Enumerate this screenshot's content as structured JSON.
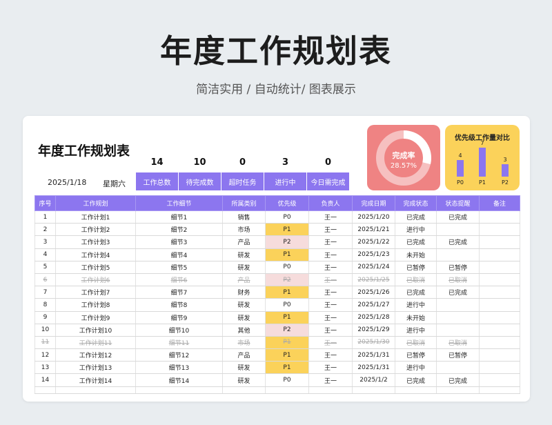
{
  "hero": {
    "title": "年度工作规划表",
    "subtitle": "简洁实用 / 自动统计/ 图表展示"
  },
  "card": {
    "title": "年度工作规划表",
    "date": "2025/1/18",
    "weekday": "星期六"
  },
  "stats": [
    {
      "value": "14",
      "label": "工作总数"
    },
    {
      "value": "10",
      "label": "待完成数"
    },
    {
      "value": "0",
      "label": "超时任务"
    },
    {
      "value": "3",
      "label": "进行中"
    },
    {
      "value": "0",
      "label": "今日需完成"
    }
  ],
  "completion": {
    "label": "完成率",
    "value": "28.57%",
    "fraction": 0.2857,
    "color": "#ef8383"
  },
  "priority_chart": {
    "title": "优先级工作量对比",
    "chart_data": {
      "type": "bar",
      "categories": [
        "P0",
        "P1",
        "P2"
      ],
      "values": [
        4,
        7,
        3
      ],
      "value_labels": [
        "4",
        "7",
        "3"
      ],
      "color": "#8c76ef"
    }
  },
  "colors": {
    "accent": "#8c76ef",
    "p1": "#fbd25a",
    "p2": "#f6dcdc",
    "cancelled_text": "#aaaaaa"
  },
  "table": {
    "headers": [
      "序号",
      "工作规划",
      "工作细节",
      "所属类别",
      "优先级",
      "负责人",
      "完成日期",
      "完成状态",
      "状态提醒",
      "备注"
    ],
    "rows": [
      {
        "no": "1",
        "plan": "工作计划1",
        "detail": "细节1",
        "category": "销售",
        "priority": "P0",
        "owner": "王一",
        "date": "2025/1/20",
        "status": "已完成",
        "reminder": "已完成",
        "note": "",
        "cancelled": false
      },
      {
        "no": "2",
        "plan": "工作计划2",
        "detail": "细节2",
        "category": "市场",
        "priority": "P1",
        "owner": "王一",
        "date": "2025/1/21",
        "status": "进行中",
        "reminder": "",
        "note": "",
        "cancelled": false
      },
      {
        "no": "3",
        "plan": "工作计划3",
        "detail": "细节3",
        "category": "产品",
        "priority": "P2",
        "owner": "王一",
        "date": "2025/1/22",
        "status": "已完成",
        "reminder": "已完成",
        "note": "",
        "cancelled": false
      },
      {
        "no": "4",
        "plan": "工作计划4",
        "detail": "细节4",
        "category": "研发",
        "priority": "P1",
        "owner": "王一",
        "date": "2025/1/23",
        "status": "未开始",
        "reminder": "",
        "note": "",
        "cancelled": false
      },
      {
        "no": "5",
        "plan": "工作计划5",
        "detail": "细节5",
        "category": "研发",
        "priority": "P0",
        "owner": "王一",
        "date": "2025/1/24",
        "status": "已暂停",
        "reminder": "已暂停",
        "note": "",
        "cancelled": false
      },
      {
        "no": "6",
        "plan": "工作计划6",
        "detail": "细节6",
        "category": "产品",
        "priority": "P2",
        "owner": "王一",
        "date": "2025/1/25",
        "status": "已取消",
        "reminder": "已取消",
        "note": "",
        "cancelled": true
      },
      {
        "no": "7",
        "plan": "工作计划7",
        "detail": "细节7",
        "category": "财务",
        "priority": "P1",
        "owner": "王一",
        "date": "2025/1/26",
        "status": "已完成",
        "reminder": "已完成",
        "note": "",
        "cancelled": false
      },
      {
        "no": "8",
        "plan": "工作计划8",
        "detail": "细节8",
        "category": "研发",
        "priority": "P0",
        "owner": "王一",
        "date": "2025/1/27",
        "status": "进行中",
        "reminder": "",
        "note": "",
        "cancelled": false
      },
      {
        "no": "9",
        "plan": "工作计划9",
        "detail": "细节9",
        "category": "研发",
        "priority": "P1",
        "owner": "王一",
        "date": "2025/1/28",
        "status": "未开始",
        "reminder": "",
        "note": "",
        "cancelled": false
      },
      {
        "no": "10",
        "plan": "工作计划10",
        "detail": "细节10",
        "category": "其他",
        "priority": "P2",
        "owner": "王一",
        "date": "2025/1/29",
        "status": "进行中",
        "reminder": "",
        "note": "",
        "cancelled": false
      },
      {
        "no": "11",
        "plan": "工作计划11",
        "detail": "细节11",
        "category": "市场",
        "priority": "P1",
        "owner": "王一",
        "date": "2025/1/30",
        "status": "已取消",
        "reminder": "已取消",
        "note": "",
        "cancelled": true
      },
      {
        "no": "12",
        "plan": "工作计划12",
        "detail": "细节12",
        "category": "产品",
        "priority": "P1",
        "owner": "王一",
        "date": "2025/1/31",
        "status": "已暂停",
        "reminder": "已暂停",
        "note": "",
        "cancelled": false
      },
      {
        "no": "13",
        "plan": "工作计划13",
        "detail": "细节13",
        "category": "研发",
        "priority": "P1",
        "owner": "王一",
        "date": "2025/1/31",
        "status": "进行中",
        "reminder": "",
        "note": "",
        "cancelled": false
      },
      {
        "no": "14",
        "plan": "工作计划14",
        "detail": "细节14",
        "category": "研发",
        "priority": "P0",
        "owner": "王一",
        "date": "2025/1/2",
        "status": "已完成",
        "reminder": "已完成",
        "note": "",
        "cancelled": false
      }
    ]
  }
}
